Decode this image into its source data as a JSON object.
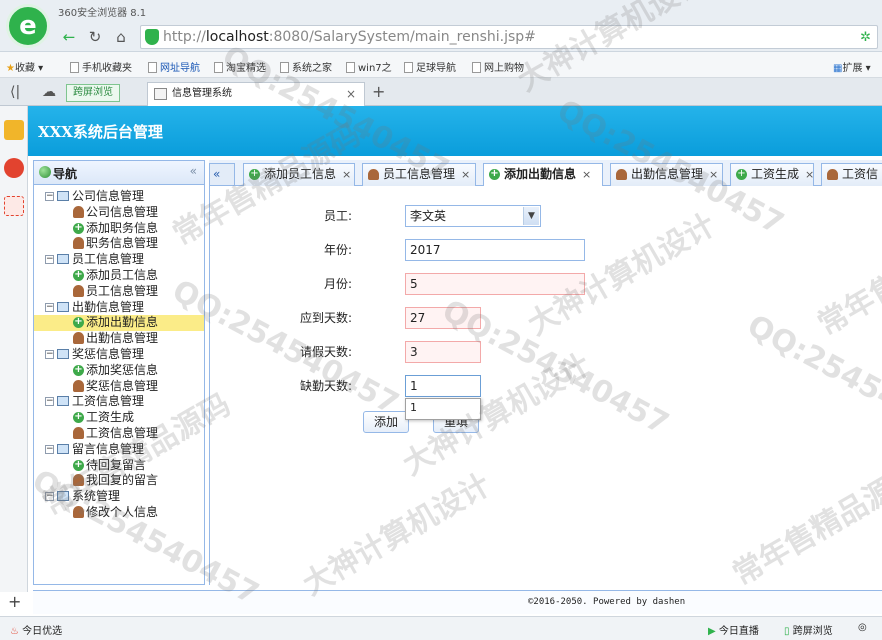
{
  "browser": {
    "name": "360安全浏览器 8.1",
    "url_prefix": "http://",
    "url_host": "localhost",
    "url_rest": ":8080/SalarySystem/main_renshi.jsp#",
    "bookmarks": [
      "收藏",
      "手机收藏夹",
      "网址导航",
      "淘宝精选",
      "系统之家",
      "win7之",
      "足球导航",
      "网上购物"
    ],
    "bookmarks_extend": "扩展",
    "tab_split_label": "跨屏浏览",
    "active_tab_title": "信息管理系统",
    "status_left": "今日优选",
    "status_live": "今日直播",
    "status_cross": "跨屏浏览"
  },
  "app": {
    "title": "XXX系统后台管理",
    "footer": "©2016-2050. Powered by dashen"
  },
  "nav": {
    "title": "导航",
    "groups": [
      {
        "label": "公司信息管理",
        "items": [
          {
            "label": "公司信息管理",
            "icon": "user"
          },
          {
            "label": "添加职务信息",
            "icon": "add"
          },
          {
            "label": "职务信息管理",
            "icon": "user"
          }
        ]
      },
      {
        "label": "员工信息管理",
        "items": [
          {
            "label": "添加员工信息",
            "icon": "add"
          },
          {
            "label": "员工信息管理",
            "icon": "user"
          }
        ]
      },
      {
        "label": "出勤信息管理",
        "items": [
          {
            "label": "添加出勤信息",
            "icon": "add"
          },
          {
            "label": "出勤信息管理",
            "icon": "user"
          }
        ]
      },
      {
        "label": "奖惩信息管理",
        "items": [
          {
            "label": "添加奖惩信息",
            "icon": "add"
          },
          {
            "label": "奖惩信息管理",
            "icon": "user"
          }
        ]
      },
      {
        "label": "工资信息管理",
        "items": [
          {
            "label": "工资生成",
            "icon": "add"
          },
          {
            "label": "工资信息管理",
            "icon": "user"
          }
        ]
      },
      {
        "label": "留言信息管理",
        "items": [
          {
            "label": "待回复留言",
            "icon": "add"
          },
          {
            "label": "我回复的留言",
            "icon": "user"
          }
        ]
      },
      {
        "label": "系统管理",
        "items": [
          {
            "label": "修改个人信息",
            "icon": "user"
          }
        ]
      }
    ],
    "selected": "添加出勤信息"
  },
  "content_tabs": [
    {
      "label": "添加员工信息",
      "icon": "add"
    },
    {
      "label": "员工信息管理",
      "icon": "user"
    },
    {
      "label": "添加出勤信息",
      "icon": "add"
    },
    {
      "label": "出勤信息管理",
      "icon": "user"
    },
    {
      "label": "工资生成",
      "icon": "add"
    },
    {
      "label": "工资信",
      "icon": "user"
    }
  ],
  "form": {
    "employee_label": "员工:",
    "employee_value": "李文英",
    "year_label": "年份:",
    "year_value": "2017",
    "month_label": "月份:",
    "month_value": "5",
    "due_days_label": "应到天数:",
    "due_days_value": "27",
    "leave_days_label": "请假天数:",
    "leave_days_value": "3",
    "absent_days_label": "缺勤天数:",
    "absent_days_value": "1",
    "autocomplete_value": "1",
    "add_button": "添加",
    "reset_button": "重填"
  },
  "watermarks": [
    "大神计算机设计",
    "QQ:254540457",
    "常年售精品源码",
    "QQ:254540457",
    "大神计算机设计",
    "常年售精品源码",
    "QQ:254540457",
    "大神计算机设计",
    "常年售精品源码",
    "QQ:254540457",
    "常年售精品源码",
    "大神计算机设计",
    "QQ:254540457",
    "常年售精品源码"
  ]
}
